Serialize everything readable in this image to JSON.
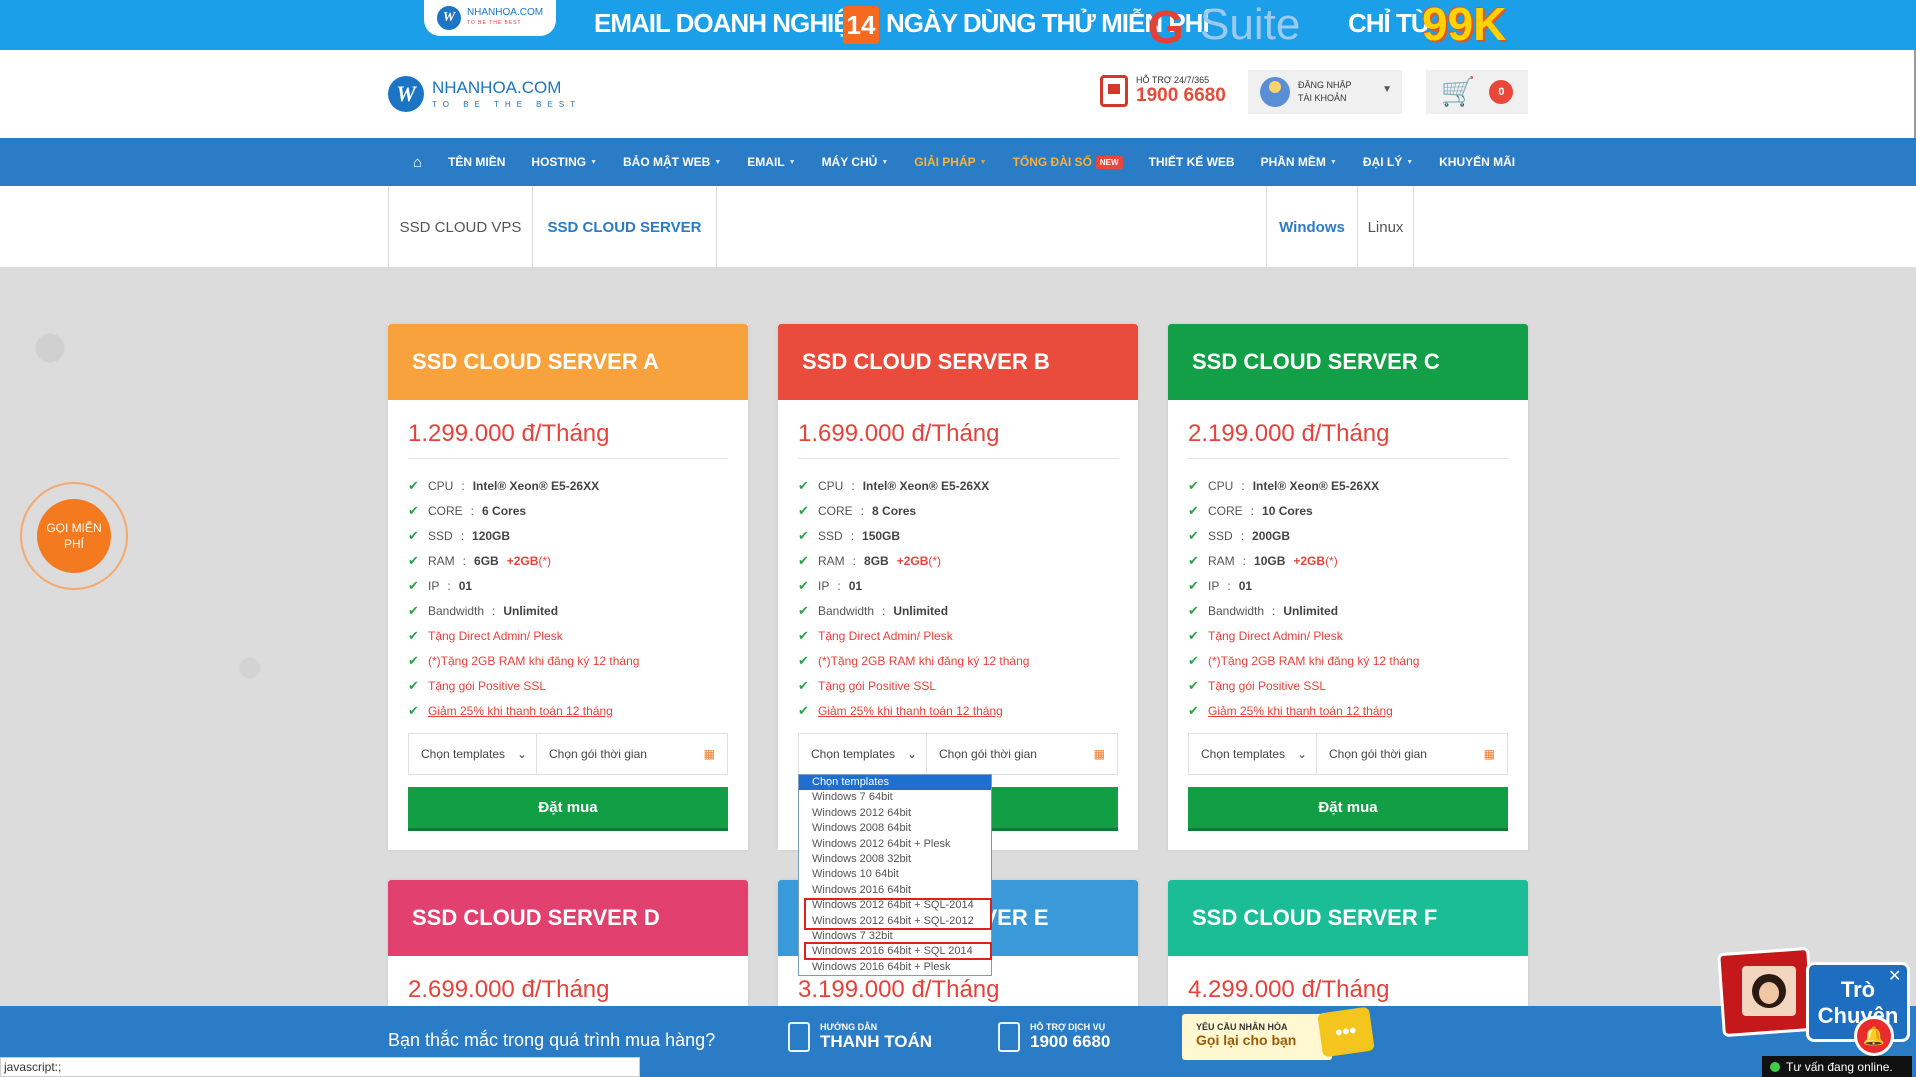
{
  "banner": {
    "logo_text": "NHANHOA.COM",
    "logo_sub": "TO BE THE BEST",
    "email": "EMAIL DOANH NGHIỆP",
    "days_num": "14",
    "days_text": "NGÀY DÙNG THỬ MIỄN PHÍ",
    "g": "G",
    "suite": "Suite",
    "chi_tu": "CHỈ TỪ",
    "price": "99K"
  },
  "header": {
    "logo_letter": "W",
    "logo_name": "NHANHOA.COM",
    "logo_slogan": "TO BE THE BEST",
    "support_label": "HỖ TRỢ 24/7/365",
    "support_phone": "1900 6680",
    "login_line1": "ĐĂNG NHẬP",
    "login_line2": "TÀI KHOẢN",
    "cart_count": "0"
  },
  "nav": {
    "items": [
      {
        "label": "TÊN MIỀN"
      },
      {
        "label": "HOSTING"
      },
      {
        "label": "BẢO MẬT WEB"
      },
      {
        "label": "EMAIL"
      },
      {
        "label": "MÁY CHỦ"
      },
      {
        "label": "GIẢI PHÁP"
      },
      {
        "label": "TỔNG ĐÀI SỐ"
      },
      {
        "label": "THIẾT KẾ WEB"
      },
      {
        "label": "PHẦN MỀM"
      },
      {
        "label": "ĐẠI LÝ"
      },
      {
        "label": "KHUYẾN MÃI"
      }
    ],
    "new_badge": "NEW"
  },
  "tabs": {
    "vps": "SSD CLOUD VPS",
    "server": "SSD CLOUD SERVER",
    "windows": "Windows",
    "linux": "Linux"
  },
  "colors": {
    "orange": "#f7a23c",
    "red": "#e94c3d",
    "green": "#139e48",
    "pink": "#e2416f",
    "blue": "#3a9ad9",
    "teal": "#1bbd97"
  },
  "common": {
    "cpu_label": "CPU",
    "cpu_value": "Intel® Xeon® E5-26XX",
    "core_label": "CORE",
    "ssd_label": "SSD",
    "ram_label": "RAM",
    "ram_bonus": "+2GB",
    "ram_mark": "(*)",
    "ip_label": "IP",
    "ip_value": "01",
    "bw_label": "Bandwidth",
    "bw_value": "Unlimited",
    "promo1": "Tặng Direct Admin/ Plesk",
    "promo2": "(*)Tặng 2GB RAM khi đăng ký 12 tháng",
    "promo3": "Tặng gói Positive SSL",
    "promo4": "Giảm 25% khi thanh toán 12 tháng",
    "select_templates": "Chọn templates",
    "select_period": "Chọn gói thời gian",
    "buy": "Đặt mua"
  },
  "cards": [
    {
      "title": "SSD CLOUD SERVER A",
      "price": "1.299.000 đ/Tháng",
      "core": "6 Cores",
      "ssd": "120GB",
      "ram": "6GB"
    },
    {
      "title": "SSD CLOUD SERVER B",
      "price": "1.699.000 đ/Tháng",
      "core": "8 Cores",
      "ssd": "150GB",
      "ram": "8GB"
    },
    {
      "title": "SSD CLOUD SERVER C",
      "price": "2.199.000 đ/Tháng",
      "core": "10 Cores",
      "ssd": "200GB",
      "ram": "10GB"
    },
    {
      "title": "SSD CLOUD SERVER D",
      "price": "2.699.000 đ/Tháng"
    },
    {
      "title": "SSD CLOUD SERVER E",
      "price": "3.199.000 đ/Tháng"
    },
    {
      "title": "SSD CLOUD SERVER F",
      "price": "4.299.000 đ/Tháng"
    }
  ],
  "dropdown": {
    "options": [
      "Chọn templates",
      "Windows 7 64bit",
      "Windows 2012 64bit",
      "Windows 2008 64bit",
      "Windows 2012 64bit + Plesk",
      "Windows 2008 32bit",
      "Windows 10 64bit",
      "Windows 2016 64bit",
      "Windows 2012 64bit + SQL-2014",
      "Windows 2012 64bit + SQL-2012",
      "Windows 7 32bit",
      "Windows 2016 64bit + SQL 2014",
      "Windows 2016 64bit + Plesk"
    ]
  },
  "call_button": "GỌI MIỄN PHÍ",
  "bottom": {
    "question": "Bạn thắc mắc trong quá trình mua hàng?",
    "guide_l1": "HƯỚNG DẪN",
    "guide_l2": "THANH TOÁN",
    "service_l1": "HỖ TRỢ DỊCH VỤ",
    "service_l2": "1900 6680",
    "request_l1": "YÊU CẦU NHÂN HÒA",
    "request_l2": "Gọi lại cho bạn",
    "bubble": "•••"
  },
  "chat": {
    "text": "Trò Chuyện",
    "online": "Tư vấn đang online."
  },
  "statusbar": "javascript:;"
}
